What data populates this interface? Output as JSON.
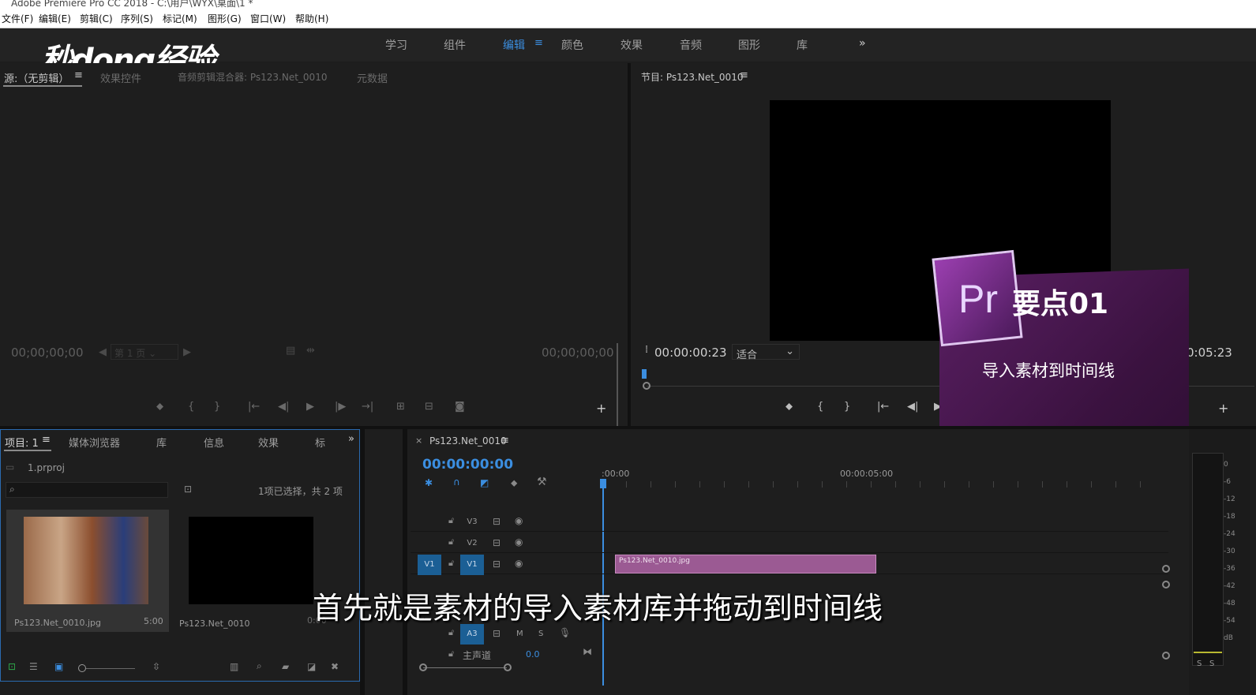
{
  "window": {
    "title": "Adobe Premiere Pro CC 2018 - C:\\用户\\WYX\\桌面\\1 *"
  },
  "menu": [
    "文件(F)",
    "编辑(E)",
    "剪辑(C)",
    "序列(S)",
    "标记(M)",
    "图形(G)",
    "窗口(W)",
    "帮助(H)"
  ],
  "workspaces": [
    "学习",
    "组件",
    "编辑",
    "颜色",
    "效果",
    "音频",
    "图形",
    "库"
  ],
  "workspace_more": "»",
  "watermark": "秒dong经验",
  "source": {
    "tabs": [
      "源:（无剪辑）",
      "效果控件",
      "音频剪辑混合器: Ps123.Net_0010",
      "元数据"
    ],
    "timecode_left": "00;00;00;00",
    "page": "第 1 页",
    "timecode_right": "00;00;00;00"
  },
  "program": {
    "tab": "节目: Ps123.Net_0010",
    "timecode": "00:00:00:23",
    "fit": "适合",
    "duration_partial": "0:05:23"
  },
  "badge": {
    "logo": "Pr",
    "title": "要点01",
    "subtitle": "导入素材到时间线",
    "accent": "#6a2a78"
  },
  "project": {
    "tabs": [
      "项目: 1",
      "媒体浏览器",
      "库",
      "信息",
      "效果",
      "标"
    ],
    "file": "1.prproj",
    "selection": "1项已选择，共 2 项",
    "items": [
      {
        "name": "Ps123.Net_0010.jpg",
        "duration": "5:00"
      },
      {
        "name": "Ps123.Net_0010",
        "duration": "0:00"
      }
    ]
  },
  "timeline": {
    "tab": "Ps123.Net_0010",
    "timecode": "00:00:00:00",
    "ruler": [
      ":00:00",
      "00:00:05:00"
    ],
    "tracks": {
      "v3": "V3",
      "v2": "V2",
      "v1_src": "V1",
      "v1": "V1",
      "a3": "A3",
      "m": "M",
      "s": "S",
      "master": "主声道",
      "master_val": "0.0"
    },
    "clip": "Ps123.Net_0010.jpg",
    "clip_color": "#9b5a93"
  },
  "meter": {
    "labels": [
      "0",
      "-6",
      "-12",
      "-18",
      "-24",
      "-30",
      "-36",
      "-42",
      "-48",
      "-54",
      "dB"
    ],
    "solo": [
      "S",
      "S"
    ]
  },
  "subtitle": "首先就是素材的导入素材库并拖动到时间线"
}
